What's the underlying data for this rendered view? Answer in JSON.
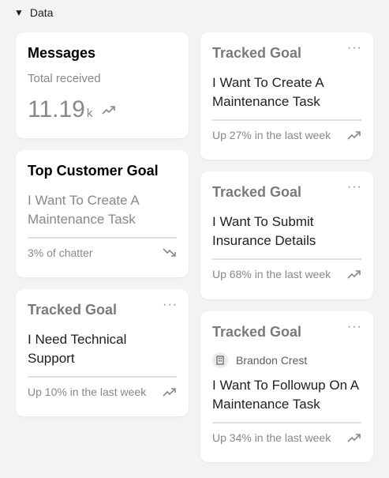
{
  "section": {
    "title": "Data",
    "caret": "▼"
  },
  "left": {
    "messages": {
      "title": "Messages",
      "subtitle": "Total received",
      "value": "11.19",
      "suffix": "k"
    },
    "top_goal": {
      "title": "Top Customer Goal",
      "goal": "I Want To Create A Maintenance Task",
      "footer": "3% of chatter"
    },
    "tracked": {
      "title": "Tracked Goal",
      "goal": "I Need Technical Support",
      "footer": "Up 10% in the last week"
    }
  },
  "right": {
    "tracked1": {
      "title": "Tracked Goal",
      "goal": "I Want To Create A Maintenance Task",
      "footer": "Up 27% in the last week"
    },
    "tracked2": {
      "title": "Tracked Goal",
      "goal": "I Want To Submit Insurance Details",
      "footer": "Up 68% in the last week"
    },
    "tracked3": {
      "title": "Tracked Goal",
      "owner": "Brandon Crest",
      "goal": "I Want To Followup On A Maintenance Task",
      "footer": "Up 34% in the last week"
    }
  },
  "more_label": "···",
  "icons": {
    "trend_up": "trending-up-icon",
    "trend_down": "trending-down-icon",
    "more": "more-icon",
    "building": "building-icon"
  }
}
